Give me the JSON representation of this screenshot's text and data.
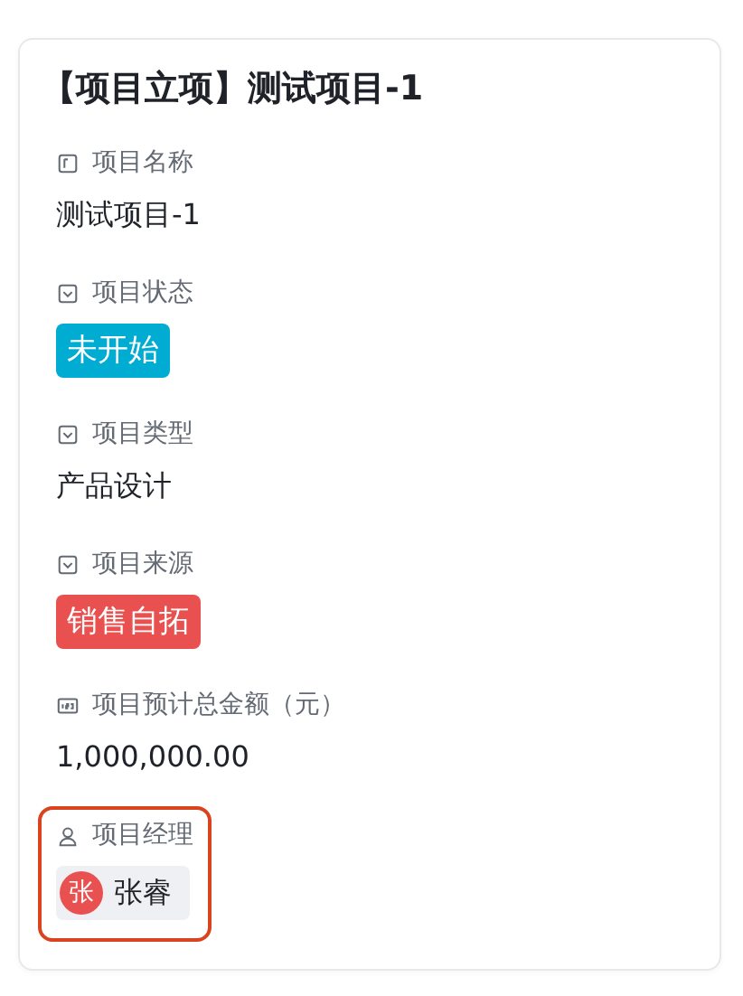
{
  "card": {
    "title": "【项目立项】测试项目-1",
    "fields": [
      {
        "label": "项目名称",
        "kind": "text",
        "value": "测试项目-1",
        "highlighted": false
      },
      {
        "label": "项目状态",
        "kind": "tag",
        "value": "未开始",
        "color": "#00acd1",
        "highlighted": false
      },
      {
        "label": "项目类型",
        "kind": "option",
        "value": "产品设计",
        "highlighted": false
      },
      {
        "label": "项目来源",
        "kind": "tag",
        "value": "销售自拓",
        "color": "#e95151",
        "highlighted": false
      },
      {
        "label": "项目预计总金额（元）",
        "kind": "number",
        "value": "1,000,000.00",
        "highlighted": false
      },
      {
        "label": "项目经理",
        "kind": "user",
        "value": "张睿",
        "avatar": "张",
        "highlighted": true
      }
    ]
  }
}
